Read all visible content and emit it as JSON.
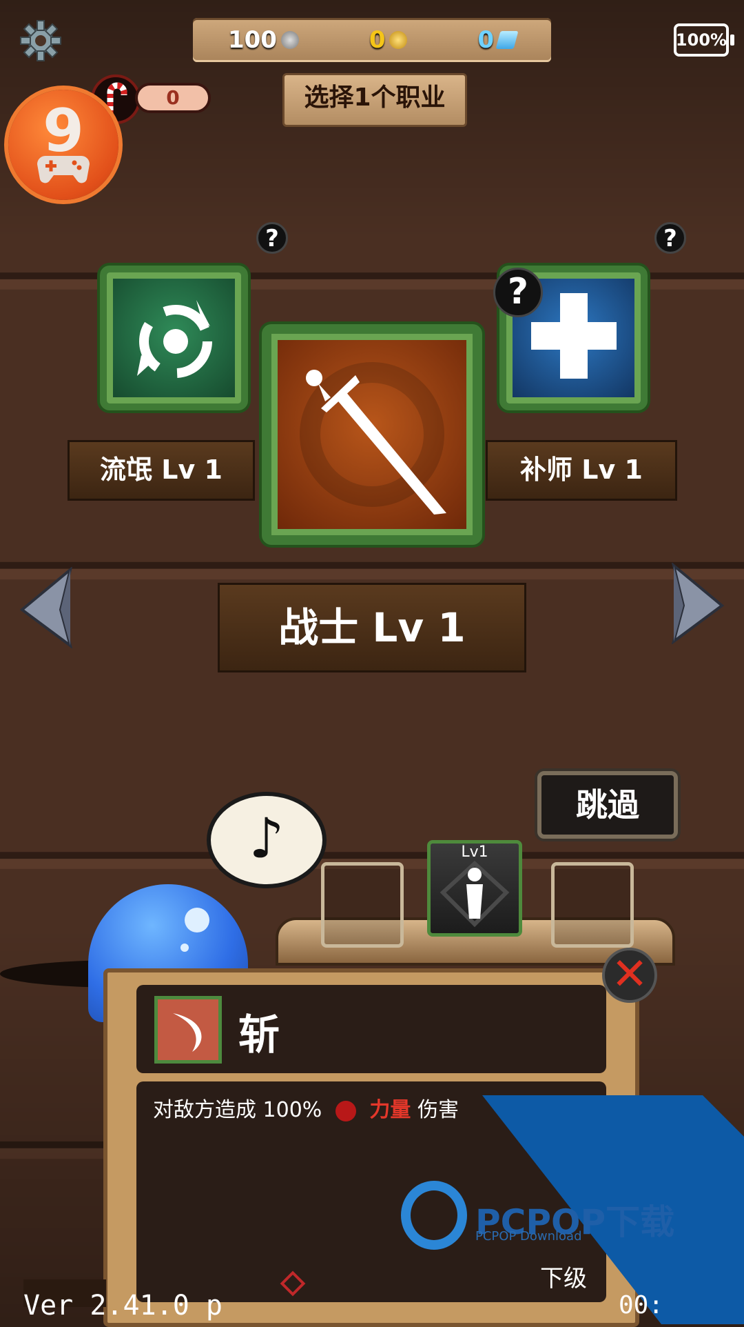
{
  "currency": {
    "stone": "100",
    "gold": "0",
    "gem": "0"
  },
  "battery": "100%",
  "candy_count": "0",
  "choose_label": "选择1个职业",
  "badge_number": "9",
  "classes": {
    "left": {
      "name": "流氓 Lv 1"
    },
    "center": {
      "name": "战士 Lv 1"
    },
    "right": {
      "name": "补师 Lv 1"
    }
  },
  "help_mark": "?",
  "skip_label": "跳過",
  "music_note": "♪",
  "slot_level": "Lv1",
  "skill": {
    "name": "斩",
    "desc_prefix": "对敌方造成 100%",
    "desc_stat": "力量",
    "desc_tail": "伤害"
  },
  "close_mark": "✕",
  "next_label": "下级",
  "version": "Ver 2.41.0 p",
  "time_prefix": "00:",
  "watermark": {
    "brand": "PCPOP下载",
    "sub": "PCPOP Download"
  },
  "colors": {
    "card_frame": "#3f7a35",
    "warrior_bg": "#b8561a",
    "rogue_bg": "#2f8a58",
    "cleric_bg": "#2d78c2",
    "stat_red": "#e3372a"
  }
}
